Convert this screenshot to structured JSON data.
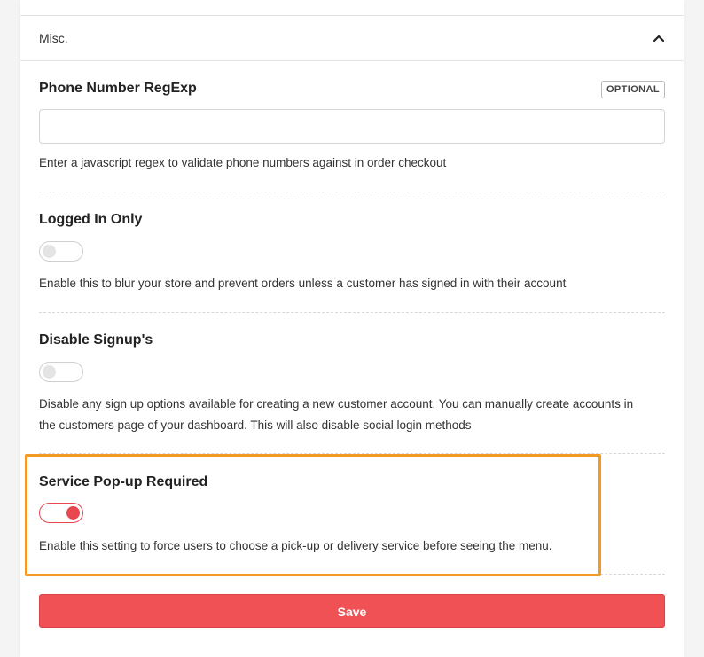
{
  "section": {
    "title": "Misc.",
    "expanded_icon": "chevron-up-icon"
  },
  "phone_regex": {
    "label": "Phone Number RegExp",
    "badge": "OPTIONAL",
    "value": "",
    "placeholder": "",
    "help": "Enter a javascript regex to validate phone numbers against in order checkout"
  },
  "logged_in_only": {
    "label": "Logged In Only",
    "enabled": false,
    "help": "Enable this to blur your store and prevent orders unless a customer has signed in with their account"
  },
  "disable_signups": {
    "label": "Disable Signup's",
    "enabled": false,
    "help_line1": "Disable any sign up options available for creating a new customer account. You can manually create accounts in",
    "help_line2": "the customers page of your dashboard. This will also disable social login methods"
  },
  "service_popup": {
    "label": "Service Pop-up Required",
    "enabled": true,
    "help": "Enable this setting to force users to choose a pick-up or delivery service before seeing the menu."
  },
  "actions": {
    "save_label": "Save"
  },
  "colors": {
    "accent": "#ef5155",
    "highlight": "#f39a26",
    "toggle_on": "#e8474f"
  }
}
